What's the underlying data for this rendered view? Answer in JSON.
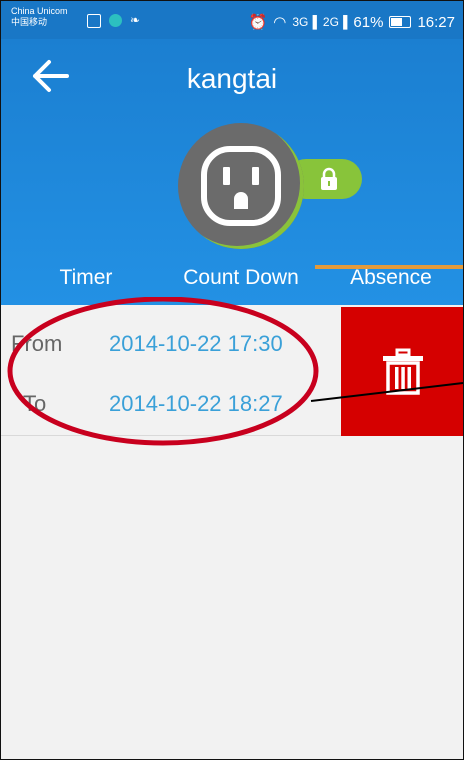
{
  "status_bar": {
    "carrier_line1": "China Unicom",
    "carrier_line2": "中国移动",
    "network_1": "3G",
    "network_2": "2G",
    "battery_percent": "61%",
    "time": "16:27"
  },
  "header": {
    "back_icon": "back-arrow-icon",
    "device_name": "kangtai",
    "socket_icon": "power-socket-icon",
    "lock_icon": "lock-icon"
  },
  "tabs": [
    {
      "label": "Timer",
      "selected": false
    },
    {
      "label": "Count Down",
      "selected": false
    },
    {
      "label": "Absence",
      "selected": true
    }
  ],
  "absence_entry": {
    "from_label": "From",
    "from_value": "2014-10-22 17:30",
    "to_label": "To",
    "to_value": "2014-10-22 18:27",
    "delete_icon": "trash-icon"
  },
  "colors": {
    "header_blue": "#2391e4",
    "delete_red": "#d50000",
    "lock_green": "#88c43a",
    "tab_indicator": "#e39a3b",
    "time_value_blue": "#3aa0d8",
    "annotation_red": "#c8001e"
  }
}
